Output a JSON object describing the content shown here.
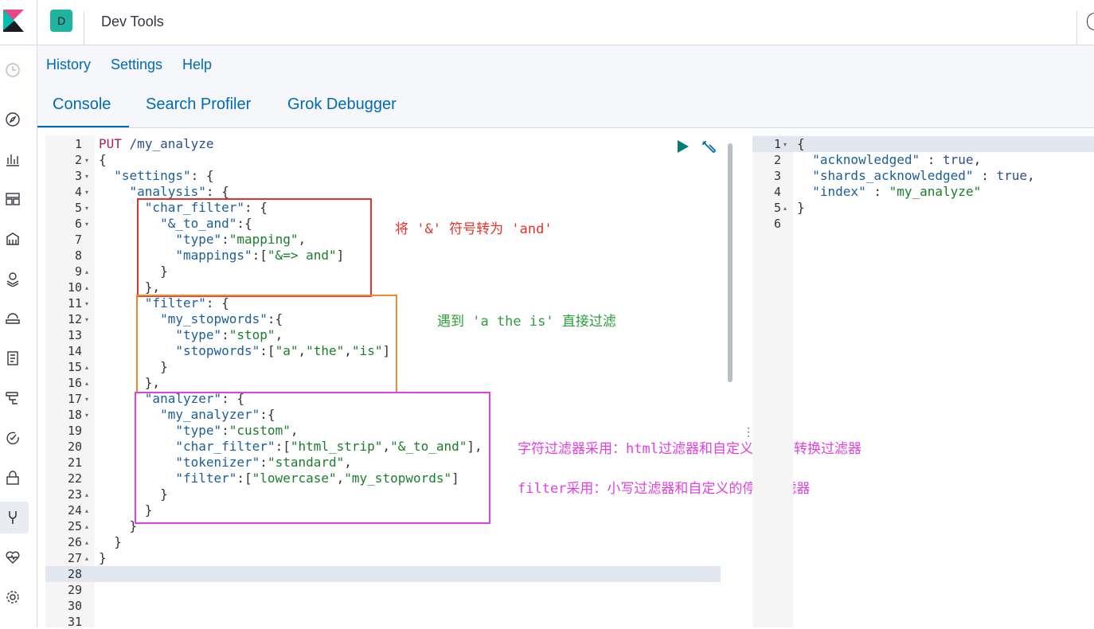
{
  "header": {
    "avatar_letter": "D",
    "title": "Dev Tools"
  },
  "topnav": {
    "links": [
      "History",
      "Settings",
      "Help"
    ],
    "tabs": [
      "Console",
      "Search Profiler",
      "Grok Debugger"
    ],
    "active_tab": "Console"
  },
  "rail": {
    "icons": [
      "recent-icon",
      "discover-icon",
      "visualize-icon",
      "dashboard-icon",
      "canvas-icon",
      "maps-icon",
      "infrastructure-icon",
      "logs-icon",
      "apm-icon",
      "uptime-icon",
      "siem-icon",
      "dev-tools-icon",
      "monitoring-icon",
      "management-icon"
    ]
  },
  "editor": {
    "line_numbers": [
      "1",
      "2",
      "3",
      "4",
      "5",
      "6",
      "7",
      "8",
      "9",
      "10",
      "11",
      "12",
      "13",
      "14",
      "15",
      "16",
      "17",
      "18",
      "19",
      "20",
      "21",
      "22",
      "23",
      "24",
      "25",
      "26",
      "27",
      "28",
      "29",
      "30",
      "31"
    ],
    "lines": [
      "PUT /my_analyze",
      "{",
      "  \"settings\": {",
      "    \"analysis\": {",
      "      \"char_filter\": {",
      "        \"&_to_and\":{",
      "          \"type\":\"mapping\",",
      "          \"mappings\":[\"&=> and\"]",
      "        }",
      "      },",
      "      \"filter\": {",
      "        \"my_stopwords\":{",
      "          \"type\":\"stop\",",
      "          \"stopwords\":[\"a\",\"the\",\"is\"]",
      "        }",
      "      },",
      "      \"analyzer\": {",
      "        \"my_analyzer\":{",
      "          \"type\":\"custom\",",
      "          \"char_filter\":[\"html_strip\",\"&_to_and\"],",
      "          \"tokenizer\":\"standard\",",
      "          \"filter\":[\"lowercase\",\"my_stopwords\"]",
      "        }",
      "      }",
      "    }",
      "  }",
      "}",
      "",
      "",
      "",
      ""
    ]
  },
  "annotations": {
    "char_filter_note": "将 '&' 符号转为 'and'",
    "filter_note": "遇到 'a the is' 直接过滤",
    "analyzer_note_1": "字符过滤器采用：html过滤器和自定义的符号转换过滤器",
    "analyzer_note_2": "filter采用：小写过滤器和自定义的停止过滤器",
    "colors": {
      "red": "#e8302a",
      "orange": "#f08a2c",
      "magenta": "#e040e0"
    }
  },
  "output": {
    "line_numbers": [
      "1",
      "2",
      "3",
      "4",
      "5",
      "6"
    ],
    "lines": [
      "{",
      "  \"acknowledged\" : true,",
      "  \"shards_acknowledged\" : true,",
      "  \"index\" : \"my_analyze\"",
      "}",
      ""
    ]
  }
}
